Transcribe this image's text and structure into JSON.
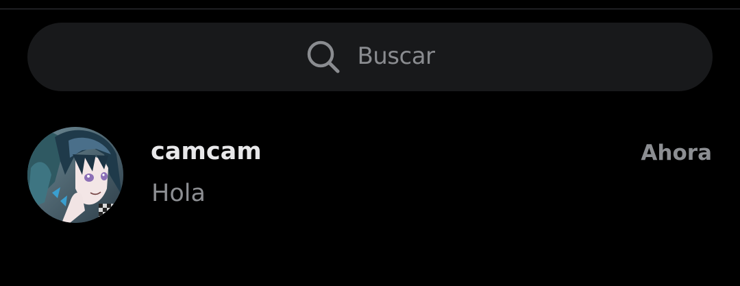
{
  "search": {
    "placeholder": "Buscar",
    "icon": "search-icon"
  },
  "chats": [
    {
      "name": "camcam",
      "preview": "Hola",
      "time": "Ahora",
      "avatar": "avatar-image"
    }
  ],
  "colors": {
    "background": "#000000",
    "search_bg": "#18191b",
    "primary_text": "#e8e8ea",
    "secondary_text": "#8c8e92"
  }
}
